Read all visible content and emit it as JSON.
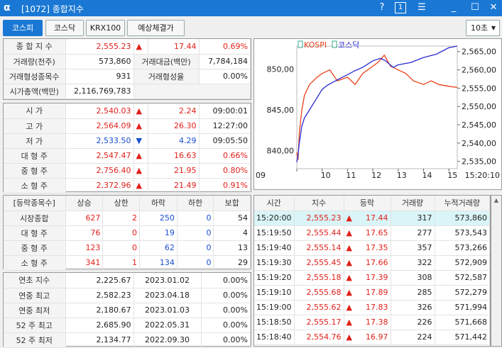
{
  "window": {
    "title": "[1072] 종합지수",
    "help": "?",
    "one": "1",
    "menu": "☰",
    "min": "_",
    "max": "☐",
    "close": "✕"
  },
  "tabs": [
    {
      "label": "코스피",
      "active": true
    },
    {
      "label": "코스닥"
    },
    {
      "label": "KRX100"
    },
    {
      "label": "예상체결가"
    }
  ],
  "interval": "10초",
  "summary": {
    "row1": {
      "label": "종 합 지 수",
      "value": "2,555.23",
      "arrow": "▲",
      "change": "17.44",
      "pct": "0.69%"
    },
    "row2": {
      "label": "거래량(천주)",
      "value": "573,860",
      "label2": "거래대금(백만)",
      "value2": "7,784,184"
    },
    "row3": {
      "label": "거래형성종목수",
      "value": "931",
      "label2": "거래형성율",
      "value2": "0.00%"
    },
    "row4": {
      "label": "시가총액(백만)",
      "value": "2,116,769,783"
    }
  },
  "prices": [
    {
      "label": "시     가",
      "value": "2,540.03",
      "arrow": "▲",
      "dir": "up",
      "change": "2.24",
      "extra": "09:00:01"
    },
    {
      "label": "고     가",
      "value": "2,564.09",
      "arrow": "▲",
      "dir": "up",
      "change": "26.30",
      "extra": "12:27:00"
    },
    {
      "label": "저     가",
      "value": "2,533.50",
      "arrow": "▼",
      "dir": "dn",
      "change": "4.29",
      "extra": "09:05:50"
    },
    {
      "label": "대 형 주",
      "value": "2,547.47",
      "arrow": "▲",
      "dir": "up",
      "change": "16.63",
      "extra": "0.66%"
    },
    {
      "label": "중 형 주",
      "value": "2,756.40",
      "arrow": "▲",
      "dir": "up",
      "change": "21.95",
      "extra": "0.80%"
    },
    {
      "label": "소 형 주",
      "value": "2,372.96",
      "arrow": "▲",
      "dir": "up",
      "change": "21.49",
      "extra": "0.91%"
    }
  ],
  "breadth": {
    "headers": [
      "[등락종목수]",
      "상승",
      "상한",
      "하락",
      "하한",
      "보합"
    ],
    "rows": [
      {
        "label": "시장종합",
        "up": "627",
        "uplim": "2",
        "down": "250",
        "downlim": "0",
        "flat": "54"
      },
      {
        "label": "대 형 주",
        "up": "76",
        "uplim": "0",
        "down": "19",
        "downlim": "0",
        "flat": "4"
      },
      {
        "label": "중 형 주",
        "up": "123",
        "uplim": "0",
        "down": "62",
        "downlim": "0",
        "flat": "13"
      },
      {
        "label": "소 형 주",
        "up": "341",
        "uplim": "1",
        "down": "134",
        "downlim": "0",
        "flat": "29"
      }
    ]
  },
  "records": [
    {
      "label": "연초  지수",
      "value": "2,225.67",
      "date": "2023.01.02",
      "pct": "0.00%"
    },
    {
      "label": "연중  최고",
      "value": "2,582.23",
      "date": "2023.04.18",
      "pct": "0.00%"
    },
    {
      "label": "연중  최저",
      "value": "2,180.67",
      "date": "2023.01.03",
      "pct": "0.00%"
    },
    {
      "label": "52 주 최고",
      "value": "2,685.90",
      "date": "2022.05.31",
      "pct": "0.00%"
    },
    {
      "label": "52 주 최저",
      "value": "2,134.77",
      "date": "2022.09.30",
      "pct": "0.00%"
    }
  ],
  "ticks": {
    "headers": [
      "시간",
      "지수",
      "등락",
      "거래량",
      "누적거래량"
    ],
    "rows": [
      {
        "time": "15:20:00",
        "index": "2,555.23",
        "change": "17.44",
        "vol": "317",
        "cum": "573,860"
      },
      {
        "time": "15:19:50",
        "index": "2,555.44",
        "change": "17.65",
        "vol": "277",
        "cum": "573,543"
      },
      {
        "time": "15:19:40",
        "index": "2,555.14",
        "change": "17.35",
        "vol": "357",
        "cum": "573,266"
      },
      {
        "time": "15:19:30",
        "index": "2,555.45",
        "change": "17.66",
        "vol": "322",
        "cum": "572,909"
      },
      {
        "time": "15:19:20",
        "index": "2,555.18",
        "change": "17.39",
        "vol": "308",
        "cum": "572,587"
      },
      {
        "time": "15:19:10",
        "index": "2,555.68",
        "change": "17.89",
        "vol": "285",
        "cum": "572,279"
      },
      {
        "time": "15:19:00",
        "index": "2,555.62",
        "change": "17.83",
        "vol": "326",
        "cum": "571,994"
      },
      {
        "time": "15:18:50",
        "index": "2,555.17",
        "change": "17.38",
        "vol": "226",
        "cum": "571,668"
      },
      {
        "time": "15:18:40",
        "index": "2,554.76",
        "change": "16.97",
        "vol": "224",
        "cum": "571,442"
      }
    ]
  },
  "chart_data": {
    "type": "line",
    "legend": [
      {
        "name": "KOSPI",
        "color": "#e8401a"
      },
      {
        "name": "코스닥",
        "color": "#2a2ad0"
      }
    ],
    "left_axis": {
      "ticks": [
        "850,00",
        "845,00",
        "840,00"
      ],
      "values": [
        850,
        845,
        840
      ]
    },
    "right_axis": {
      "ticks": [
        "2,565,00",
        "2,560,00",
        "2,555,00",
        "2,550,00",
        "2,545,00",
        "2,540,00",
        "2,535,00"
      ],
      "values": [
        2565,
        2560,
        2555,
        2550,
        2545,
        2540,
        2535
      ]
    },
    "x_ticks": [
      "09",
      "10",
      "11",
      "12",
      "13",
      "14",
      "15"
    ],
    "time_label": "15:20:10",
    "series": [
      {
        "name": "KOSPI",
        "axis": "right",
        "x": [
          9.0,
          9.05,
          9.1,
          9.2,
          9.3,
          9.5,
          9.8,
          10.0,
          10.3,
          10.6,
          11.0,
          11.3,
          11.6,
          12.0,
          12.2,
          12.45,
          12.7,
          13.0,
          13.3,
          13.6,
          14.0,
          14.3,
          14.6,
          15.0,
          15.33
        ],
        "y": [
          2537.5,
          2535.5,
          2543,
          2549,
          2553,
          2556,
          2558,
          2559,
          2560,
          2557,
          2558,
          2556,
          2559,
          2561,
          2562,
          2564,
          2561,
          2560,
          2559,
          2557,
          2556,
          2557,
          2556,
          2555.5,
          2555.2
        ]
      },
      {
        "name": "코스닥",
        "axis": "left",
        "x": [
          9.0,
          9.05,
          9.1,
          9.2,
          9.3,
          9.5,
          9.8,
          10.0,
          10.2,
          10.5,
          10.8,
          11.0,
          11.3,
          11.6,
          12.0,
          12.3,
          12.5,
          12.8,
          13.0,
          13.5,
          14.0,
          14.5,
          15.0,
          15.33
        ],
        "y": [
          838.6,
          839.5,
          841,
          843,
          844,
          845,
          846.5,
          847.5,
          848,
          848.5,
          849,
          849.3,
          849.8,
          850.2,
          851,
          851.3,
          851,
          850.2,
          850.5,
          850.8,
          851.4,
          851.8,
          852.6,
          852.8
        ]
      }
    ]
  }
}
